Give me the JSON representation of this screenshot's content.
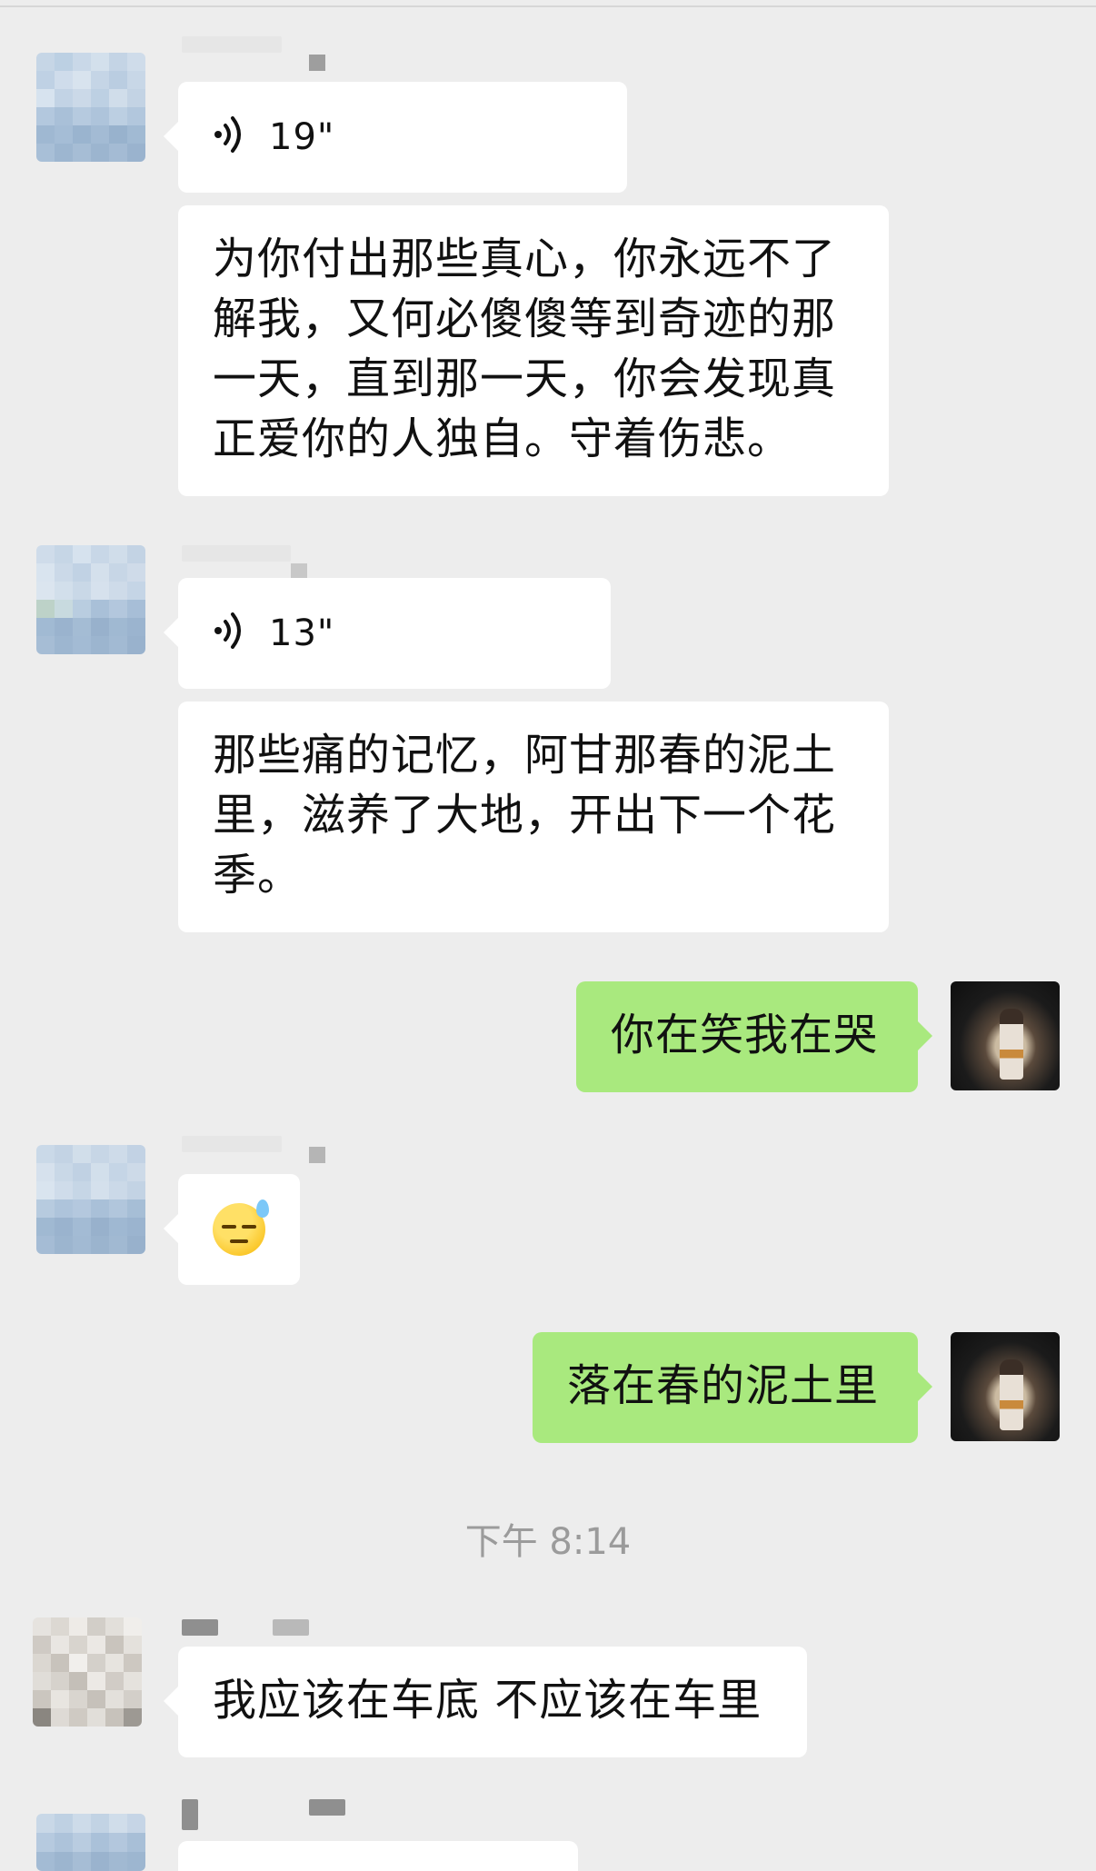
{
  "messages": [
    {
      "id": "m1",
      "side": "left",
      "type": "voice",
      "duration": "19\"",
      "icon": "voice-wave-icon"
    },
    {
      "id": "m2",
      "side": "left",
      "type": "text",
      "text": "为你付出那些真心，你永远不了解我，又何必傻傻等到奇迹的那一天，直到那一天，你会发现真正爱你的人独自。守着伤悲。"
    },
    {
      "id": "m3",
      "side": "left",
      "type": "voice",
      "duration": "13\"",
      "icon": "voice-wave-icon"
    },
    {
      "id": "m4",
      "side": "left",
      "type": "text",
      "text": "那些痛的记忆，阿甘那春的泥土里，滋养了大地，开出下一个花季。"
    },
    {
      "id": "m5",
      "side": "right",
      "type": "text",
      "text": "你在笑我在哭"
    },
    {
      "id": "m6",
      "side": "left",
      "type": "emoji",
      "emoji": "sweat-face-emoji"
    },
    {
      "id": "m7",
      "side": "right",
      "type": "text",
      "text": "落在春的泥土里"
    },
    {
      "id": "m8",
      "side": "left",
      "type": "text",
      "text": "我应该在车底 不应该在车里"
    }
  ],
  "timestamp": "下午 8:14",
  "colors": {
    "background": "#ededed",
    "incoming_bubble": "#ffffff",
    "outgoing_bubble": "#a9e97e",
    "timestamp_text": "#9b9b9b"
  }
}
